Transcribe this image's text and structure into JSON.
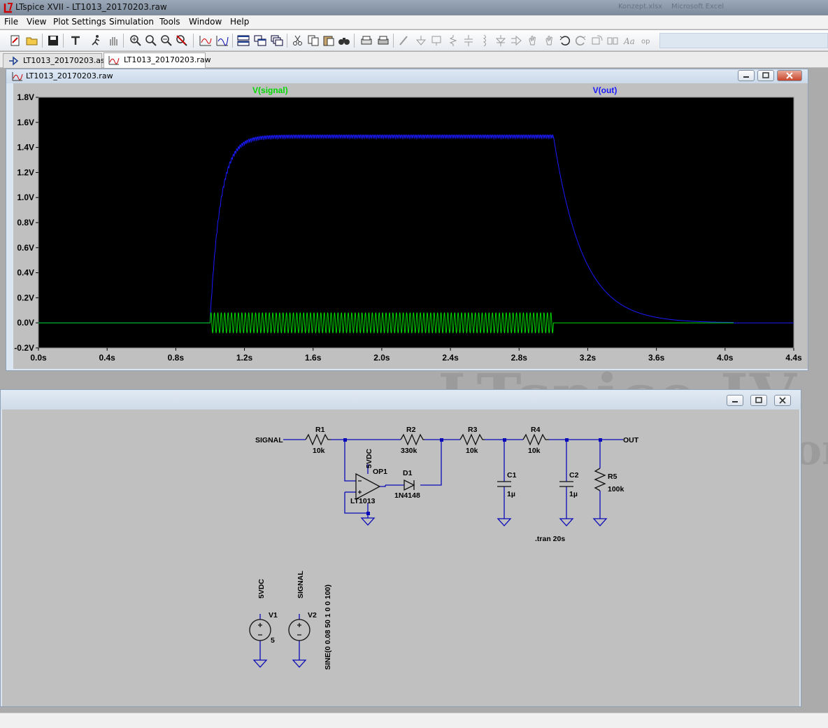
{
  "app": {
    "title": "LTspice XVII - LT1013_20170203.raw",
    "ghost_right": [
      "Konzept.xlsx",
      "Microsoft Excel"
    ]
  },
  "menu": [
    "File",
    "View",
    "Plot Settings",
    "Simulation",
    "Tools",
    "Window",
    "Help"
  ],
  "toolbar_icons": [
    "new-schematic-icon",
    "open-icon",
    "save-icon",
    "control-panel-icon",
    "run-icon",
    "halt-icon",
    "zoom-in-icon",
    "zoom-to-fit-icon",
    "zoom-out-icon",
    "cancel-zoom-icon",
    "autorange-icon",
    "add-trace-icon",
    "tile-vertical-icon",
    "tile-horizontal-icon",
    "cascade-icon",
    "cut-icon",
    "copy-icon",
    "paste-icon",
    "find-icon",
    "print-preview-icon",
    "print-icon",
    "wire-icon",
    "ground-icon",
    "label-icon",
    "resistor-icon",
    "capacitor-icon",
    "inductor-icon",
    "diode-icon",
    "component-icon",
    "move-icon",
    "drag-icon",
    "undo-icon",
    "redo-icon",
    "rotate-icon",
    "mirror-icon",
    "text-icon",
    "spice-directive-icon"
  ],
  "tabs": [
    {
      "label": "LT1013_20170203.asc",
      "active": false
    },
    {
      "label": "LT1013_20170203.raw",
      "active": true
    }
  ],
  "background_text": [
    "LTspice IV",
    "on"
  ],
  "waveform_window": {
    "title": "LT1013_20170203.raw"
  },
  "chart_data": {
    "type": "line",
    "title": "",
    "xlabel": "",
    "ylabel": "",
    "xlim": [
      0.0,
      4.4
    ],
    "ylim": [
      -0.2,
      1.8
    ],
    "x_ticks": [
      "0.0s",
      "0.4s",
      "0.8s",
      "1.2s",
      "1.6s",
      "2.0s",
      "2.4s",
      "2.8s",
      "3.2s",
      "3.6s",
      "4.0s",
      "4.4s"
    ],
    "y_ticks": [
      "1.8V",
      "1.6V",
      "1.4V",
      "1.2V",
      "1.0V",
      "0.8V",
      "0.6V",
      "0.4V",
      "0.2V",
      "0.0V",
      "-0.2V"
    ],
    "background": "#000000",
    "grid": false,
    "series": [
      {
        "name": "V(signal)",
        "color": "#00d800",
        "segments": [
          {
            "t_start": 0.0,
            "t_end": 1.0,
            "kind": "flat",
            "level": 0.0
          },
          {
            "t_start": 1.0,
            "t_end": 3.0,
            "kind": "sine",
            "amplitude": 0.08,
            "frequency_hz": 50,
            "offset": 0.0
          },
          {
            "t_start": 3.0,
            "t_end": 4.05,
            "kind": "flat",
            "level": 0.0
          }
        ]
      },
      {
        "name": "V(out)",
        "color": "#1a1aff",
        "segments": [
          {
            "t_start": 0.0,
            "t_end": 1.0,
            "kind": "flat",
            "level": 0.0
          },
          {
            "t_start": 1.0,
            "t_end": 3.0,
            "kind": "rise",
            "steady": 1.47,
            "ripple": 0.03,
            "time_constant": 0.06
          },
          {
            "t_start": 3.0,
            "t_end": 4.05,
            "kind": "decay",
            "from": 1.49,
            "time_constant": 0.17
          }
        ]
      }
    ]
  },
  "schematic": {
    "net_labels": {
      "signal": "SIGNAL",
      "out": "OUT",
      "supply": "5VDC",
      "signal_src": "SIGNAL"
    },
    "R1": {
      "name": "R1",
      "value": "10k"
    },
    "R2": {
      "name": "R2",
      "value": "330k"
    },
    "R3": {
      "name": "R3",
      "value": "10k"
    },
    "R4": {
      "name": "R4",
      "value": "10k"
    },
    "R5": {
      "name": "R5",
      "value": "100k"
    },
    "C1": {
      "name": "C1",
      "value": "1µ"
    },
    "C2": {
      "name": "C2",
      "value": "1µ"
    },
    "D1": {
      "name": "D1",
      "value": "1N4148"
    },
    "OP1": {
      "name": "OP1",
      "value": "LT1013"
    },
    "V1": {
      "name": "V1",
      "value": "5"
    },
    "V2": {
      "name": "V2",
      "value": "SINE(0 0.08 50 1 0 0 100)"
    },
    "directive": ".tran 20s"
  }
}
